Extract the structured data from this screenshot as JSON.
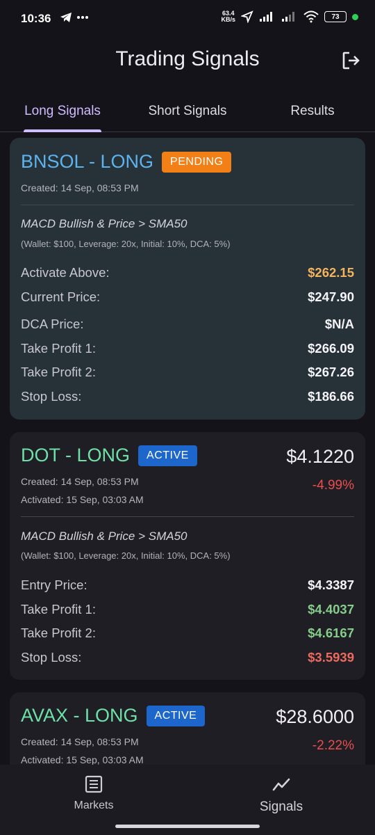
{
  "status_bar": {
    "time": "10:36",
    "net_speed_value": "63.4",
    "net_speed_unit": "KB/s",
    "battery": "73"
  },
  "app_bar": {
    "title": "Trading Signals"
  },
  "tabs": [
    {
      "label": "Long Signals",
      "active": true
    },
    {
      "label": "Short Signals",
      "active": false
    },
    {
      "label": "Results",
      "active": false
    }
  ],
  "signals": [
    {
      "ticker": "BNSOL - LONG",
      "status": "PENDING",
      "created": "Created: 14 Sep, 08:53 PM",
      "strategy": "MACD Bullish & Price > SMA50",
      "params": "(Wallet: $100, Leverage: 20x, Initial: 10%, DCA: 5%)",
      "rows": [
        {
          "label": "Activate Above:",
          "value": "$262.15"
        },
        {
          "label": "Current Price:",
          "value": "$247.90"
        },
        {
          "label": "DCA Price:",
          "value": "$N/A"
        },
        {
          "label": "Take Profit 1:",
          "value": "$266.09"
        },
        {
          "label": "Take Profit 2:",
          "value": "$267.26"
        },
        {
          "label": "Stop Loss:",
          "value": "$186.66"
        }
      ]
    },
    {
      "ticker": "DOT - LONG",
      "status": "ACTIVE",
      "current_price": "$4.1220",
      "change": "-4.99%",
      "created": "Created: 14 Sep, 08:53 PM",
      "activated": "Activated: 15 Sep, 03:03 AM",
      "strategy": "MACD Bullish & Price > SMA50",
      "params": "(Wallet: $100, Leverage: 20x, Initial: 10%, DCA: 5%)",
      "rows": [
        {
          "label": "Entry Price:",
          "value": "$4.3387"
        },
        {
          "label": "Take Profit 1:",
          "value": "$4.4037"
        },
        {
          "label": "Take Profit 2:",
          "value": "$4.6167"
        },
        {
          "label": "Stop Loss:",
          "value": "$3.5939"
        }
      ]
    },
    {
      "ticker": "AVAX - LONG",
      "status": "ACTIVE",
      "current_price": "$28.6000",
      "change": "-2.22%",
      "created": "Created: 14 Sep, 08:53 PM",
      "activated": "Activated: 15 Sep, 03:03 AM"
    }
  ],
  "bottom_nav": [
    {
      "label": "Markets",
      "icon": "list-icon",
      "active": false
    },
    {
      "label": "Signals",
      "icon": "trend-chart-icon",
      "active": true
    }
  ],
  "colors": {
    "background": "#141319",
    "accent": "#cfbdfe",
    "pending_badge": "#f28017",
    "active_badge": "#1d67cc",
    "profit_green": "#86cc8a",
    "loss_red": "#ec6a5e",
    "activate_orange": "#f4b45d"
  }
}
